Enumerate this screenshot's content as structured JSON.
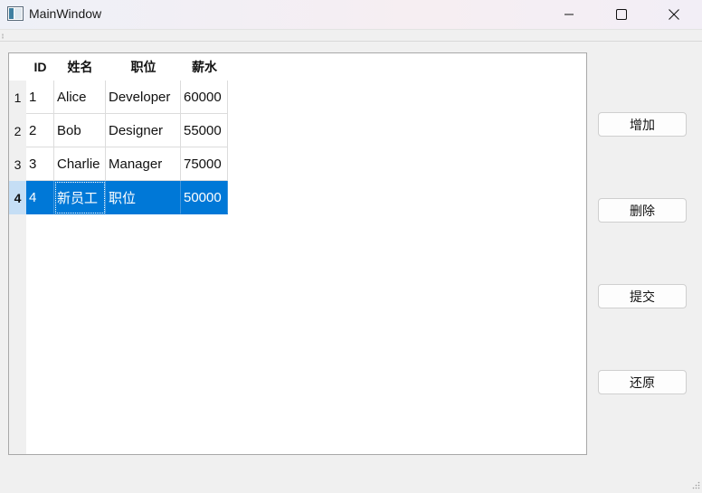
{
  "window": {
    "title": "MainWindow"
  },
  "table": {
    "columns": [
      "ID",
      "姓名",
      "职位",
      "薪水"
    ],
    "row_headers": [
      "1",
      "2",
      "3",
      "4"
    ],
    "rows": [
      [
        "1",
        "Alice",
        "Developer",
        "60000"
      ],
      [
        "2",
        "Bob",
        "Designer",
        "55000"
      ],
      [
        "3",
        "Charlie",
        "Manager",
        "75000"
      ],
      [
        "4",
        "新员工",
        "职位",
        "50000"
      ]
    ],
    "selected_row": 4,
    "selection_color": "#0078d7"
  },
  "buttons": {
    "add": "增加",
    "delete": "删除",
    "submit": "提交",
    "revert": "还原"
  },
  "icons": {
    "app": "window-app-icon",
    "minimize": "minimize-icon",
    "maximize": "maximize-icon",
    "close": "close-icon"
  }
}
